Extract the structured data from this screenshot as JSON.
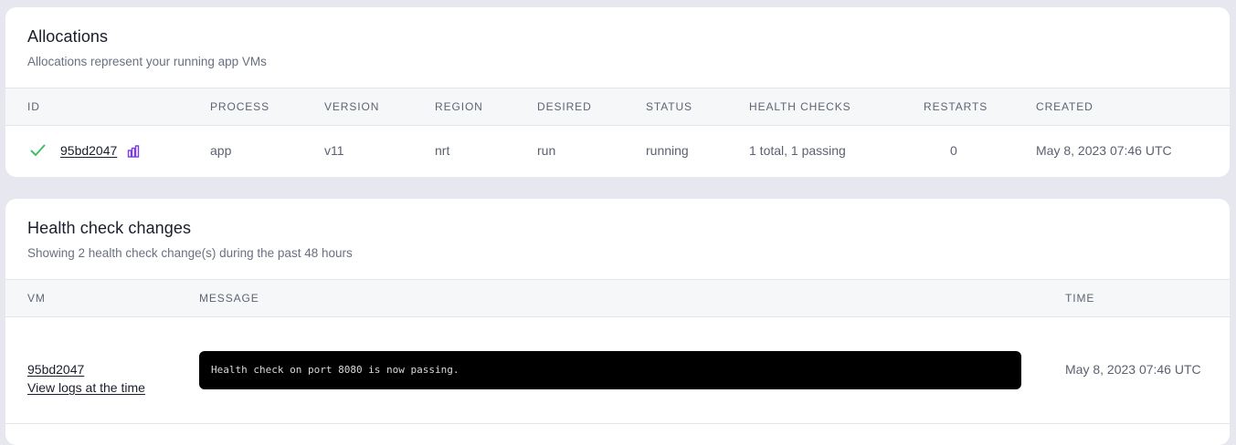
{
  "allocations": {
    "title": "Allocations",
    "subtitle": "Allocations represent your running app VMs",
    "columns": [
      "ID",
      "PROCESS",
      "VERSION",
      "REGION",
      "DESIRED",
      "STATUS",
      "HEALTH CHECKS",
      "RESTARTS",
      "CREATED"
    ],
    "rows": [
      {
        "status_icon": "check-icon",
        "id": "95bd2047",
        "metrics_icon": "bar-chart-icon",
        "process": "app",
        "version": "v11",
        "region": "nrt",
        "desired": "run",
        "status": "running",
        "health_checks": "1 total, 1 passing",
        "restarts": "0",
        "created": "May 8, 2023 07:46 UTC"
      }
    ]
  },
  "health_changes": {
    "title": "Health check changes",
    "subtitle": "Showing 2 health check change(s) during the past 48 hours",
    "columns": [
      "VM",
      "MESSAGE",
      "TIME"
    ],
    "rows": [
      {
        "vm": "95bd2047",
        "logs_link": "View logs at the time",
        "message": "Health check on port 8080 is now passing.",
        "time": "May 8, 2023 07:46 UTC"
      }
    ]
  },
  "colors": {
    "page_bg": "#e7e8ef",
    "card_bg": "#ffffff",
    "header_bg": "#f6f7f9",
    "check_green": "#3fbf6a",
    "icon_purple": "#7c3aed",
    "terminal_bg": "#000000"
  }
}
